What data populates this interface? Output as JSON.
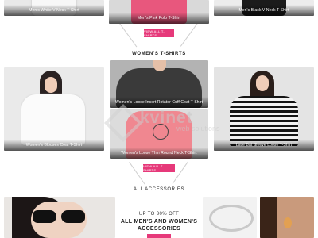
{
  "top_row": [
    {
      "caption": "Men's White V-Neck T-Shirt",
      "bg": "#e9e9e9",
      "shirt": "#f4f4f4"
    },
    {
      "caption": "Men's Pink Polo T-Shirt",
      "bg": "#dcdcdc",
      "shirt": "#e8577d"
    },
    {
      "caption": "Men's Black V-Neck T-Shirt",
      "bg": "#ececec",
      "shirt": "#1b1b1b"
    }
  ],
  "men_view_all": "VIEW ALL T-SHIRTS",
  "women_heading": "WOMEN'S T-SHIRTS",
  "women_products": [
    {
      "caption": "Women's Blouses Coat T-Shirt"
    },
    {
      "caption": "Women's Loose Insert Rotator Cuff Coat T-Shirt"
    },
    {
      "caption": "Women's Loose Thin Round Neck T-Shirt"
    },
    {
      "caption": "Lace Bat Sleeve Loose T-Shirt"
    }
  ],
  "women_view_all": "VIEW ALL T-SHIRTS",
  "accessories_heading": "ALL ACCESSORIES",
  "promo": {
    "line1": "UP TO 30% OFF",
    "line2": "ALL MEN'S AND WOMEN'S",
    "line3": "ACCESSORIES"
  },
  "watermark": {
    "brand": "kvinet",
    "tagline": "web solutions"
  },
  "colors": {
    "accent": "#e6397a",
    "text": "#222222",
    "line": "#cfcfcf"
  }
}
